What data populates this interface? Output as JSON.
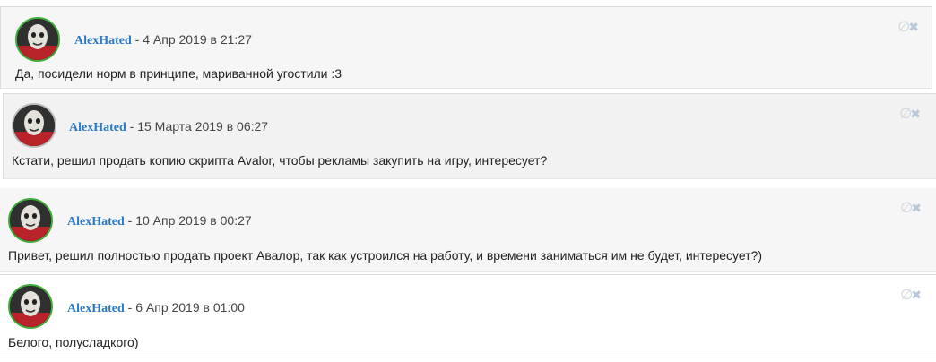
{
  "messages": [
    {
      "author": "AlexHated",
      "separator": "-",
      "date": "4 Апр 2019 в 21:27",
      "text": "Да, посидели норм в принципе, мариванной угостили :3",
      "tools": {
        "ignore_icon": "∅",
        "delete_icon": "✖"
      }
    },
    {
      "author": "AlexHated",
      "separator": "-",
      "date": "15 Марта 2019 в 06:27",
      "text": "Кстати, решил продать копию скрипта Avalor, чтобы рекламы закупить на игру, интересует?",
      "tools": {
        "ignore_icon": "∅",
        "delete_icon": "✖"
      }
    },
    {
      "author": "AlexHated",
      "separator": "-",
      "date": "10 Апр 2019 в 00:27",
      "text": "Привет, решил полностью продать проект Авалор, так как устроился на работу, и времени заниматься им не будет, интересует?)",
      "tools": {
        "ignore_icon": "∅",
        "delete_icon": "✖"
      }
    },
    {
      "author": "AlexHated",
      "separator": "-",
      "date": "6 Апр 2019 в 01:00",
      "text": "Белого, полусладкого)",
      "tools": {
        "ignore_icon": "∅",
        "delete_icon": "✖"
      }
    }
  ],
  "colors": {
    "author_link": "#2a79c8",
    "avatar_online_border": "#3fae3a",
    "avatar_offline_border": "#bdbdbd"
  }
}
